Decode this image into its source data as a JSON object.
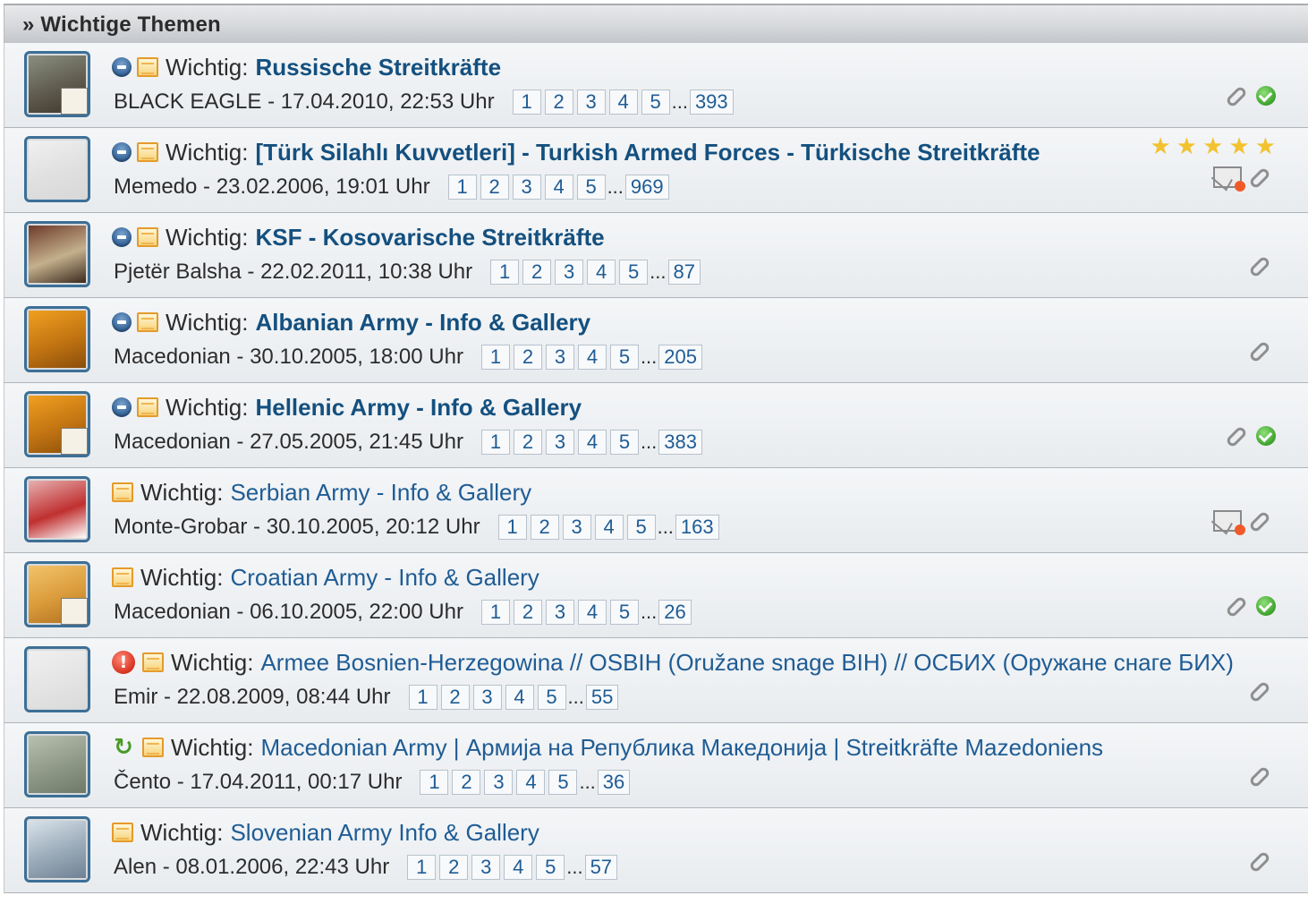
{
  "header": {
    "title": "» Wichtige Themen"
  },
  "prefix": "Wichtig:",
  "threads": [
    {
      "icon": "announcement-icon",
      "title": "Russische Streitkräfte",
      "bold": true,
      "author_date": "BLACK EAGLE - 17.04.2010, 22:53 Uhr",
      "pages": [
        "1",
        "2",
        "3",
        "4",
        "5"
      ],
      "last_page": "393",
      "badges": [
        "attachment-icon",
        "check-icon"
      ],
      "avatar_colors": [
        "#8a8f80",
        "#5f5b4e",
        "#3d352b"
      ],
      "mini": true
    },
    {
      "icon": "announcement-icon",
      "title": "[Türk Silahlı Kuvvetleri] - Turkish Armed Forces - Türkische Streitkräfte",
      "bold": true,
      "author_date": "Memedo - 23.02.2006, 19:01 Uhr",
      "pages": [
        "1",
        "2",
        "3",
        "4",
        "5"
      ],
      "last_page": "969",
      "badges": [
        "mail-icon",
        "attachment-icon"
      ],
      "rating": 5,
      "avatar_colors": [
        "#f0f0f0",
        "#e0e0e0",
        "#d8d8d8"
      ],
      "mini": false
    },
    {
      "icon": "announcement-icon",
      "title": "KSF - Kosovarische Streitkräfte",
      "bold": true,
      "author_date": "Pjetër Balsha - 22.02.2011, 10:38 Uhr",
      "pages": [
        "1",
        "2",
        "3",
        "4",
        "5"
      ],
      "last_page": "87",
      "badges": [
        "attachment-icon"
      ],
      "avatar_colors": [
        "#6e3b2a",
        "#c4b08c",
        "#3b2a1f"
      ],
      "mini": false
    },
    {
      "icon": "announcement-icon",
      "title": "Albanian Army - Info & Gallery",
      "bold": true,
      "author_date": "Macedonian - 30.10.2005, 18:00 Uhr",
      "pages": [
        "1",
        "2",
        "3",
        "4",
        "5"
      ],
      "last_page": "205",
      "badges": [
        "attachment-icon"
      ],
      "avatar_colors": [
        "#f0a020",
        "#c27412",
        "#8a4e0a"
      ],
      "mini": false
    },
    {
      "icon": "announcement-icon",
      "title": "Hellenic Army - Info & Gallery",
      "bold": true,
      "author_date": "Macedonian - 27.05.2005, 21:45 Uhr",
      "pages": [
        "1",
        "2",
        "3",
        "4",
        "5"
      ],
      "last_page": "383",
      "badges": [
        "attachment-icon",
        "check-icon"
      ],
      "avatar_colors": [
        "#f0a020",
        "#c27412",
        "#8a4e0a"
      ],
      "mini": true
    },
    {
      "icon": "",
      "title": "Serbian Army - Info & Gallery",
      "bold": false,
      "author_date": "Monte-Grobar - 30.10.2005, 20:12 Uhr",
      "pages": [
        "1",
        "2",
        "3",
        "4",
        "5"
      ],
      "last_page": "163",
      "badges": [
        "mail-icon",
        "attachment-icon"
      ],
      "avatar_colors": [
        "#e7b0b0",
        "#c03030",
        "#ffffff"
      ],
      "mini": false
    },
    {
      "icon": "",
      "title": "Croatian Army - Info & Gallery",
      "bold": false,
      "author_date": "Macedonian - 06.10.2005, 22:00 Uhr",
      "pages": [
        "1",
        "2",
        "3",
        "4",
        "5"
      ],
      "last_page": "26",
      "badges": [
        "attachment-icon",
        "check-icon"
      ],
      "avatar_colors": [
        "#f3c36a",
        "#d99a3a",
        "#b07020"
      ],
      "mini": true
    },
    {
      "icon": "alert-icon",
      "title": "Armee Bosnien-Herzegowina // OSBIH (Oružane snage BIH) // ОСБИХ (Оружане снаге БИХ)",
      "bold": false,
      "author_date": "Emir - 22.08.2009, 08:44 Uhr",
      "pages": [
        "1",
        "2",
        "3",
        "4",
        "5"
      ],
      "last_page": "55",
      "badges": [
        "attachment-icon"
      ],
      "avatar_colors": [
        "#f0f0f0",
        "#e4e4e4",
        "#dadada"
      ],
      "mini": false
    },
    {
      "icon": "hot-thread-icon",
      "title": "Macedonian Army | Армија на Република Македонија | Streitkräfte Mazedoniens",
      "bold": false,
      "author_date": "Čento - 17.04.2011, 00:17 Uhr",
      "pages": [
        "1",
        "2",
        "3",
        "4",
        "5"
      ],
      "last_page": "36",
      "badges": [
        "attachment-icon"
      ],
      "avatar_colors": [
        "#b8c0b0",
        "#8e9886",
        "#6e7a68"
      ],
      "mini": false
    },
    {
      "icon": "",
      "title": "Slovenian Army Info & Gallery",
      "bold": false,
      "author_date": "Alen - 08.01.2006, 22:43 Uhr",
      "pages": [
        "1",
        "2",
        "3",
        "4",
        "5"
      ],
      "last_page": "57",
      "badges": [
        "attachment-icon"
      ],
      "avatar_colors": [
        "#d8e2ea",
        "#9aaab8",
        "#6f8294"
      ],
      "mini": false
    }
  ]
}
